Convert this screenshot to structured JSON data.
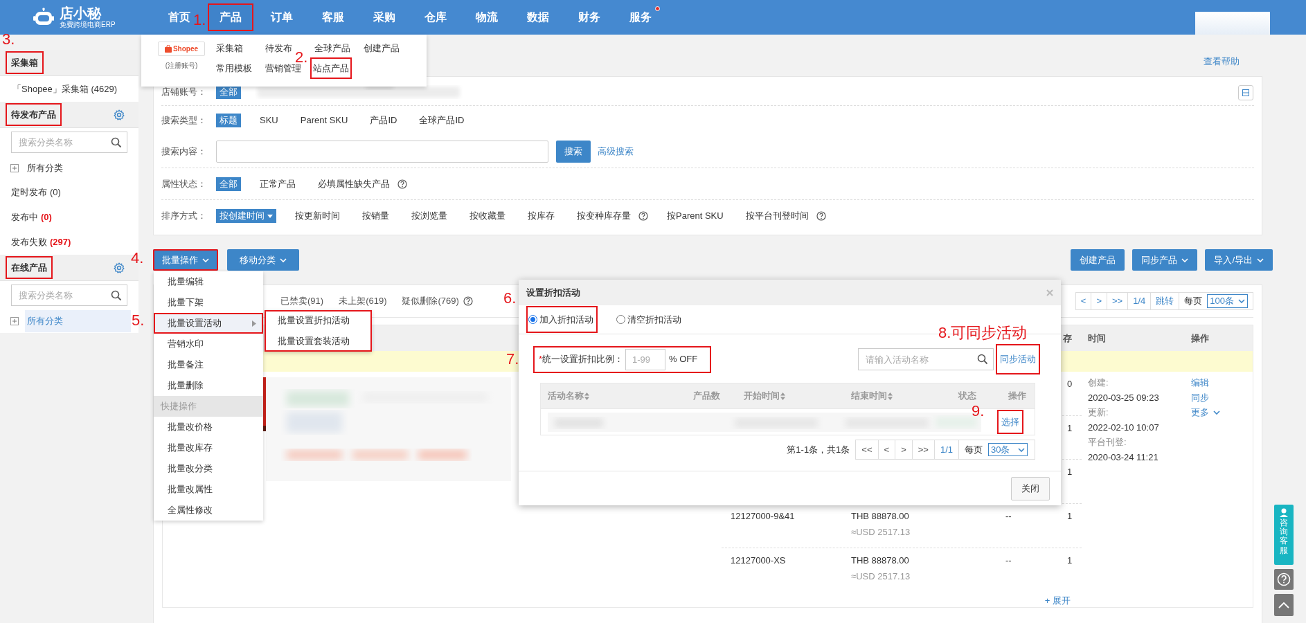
{
  "nav": {
    "logo_text": "店小秘",
    "logo_sub": "免费跨境电商ERP",
    "items": [
      {
        "label": "首页",
        "selected": false,
        "badge": false
      },
      {
        "label": "产品",
        "selected": true,
        "badge": false
      },
      {
        "label": "订单",
        "selected": false,
        "badge": false
      },
      {
        "label": "客服",
        "selected": false,
        "badge": false
      },
      {
        "label": "采购",
        "selected": false,
        "badge": false
      },
      {
        "label": "仓库",
        "selected": false,
        "badge": false
      },
      {
        "label": "物流",
        "selected": false,
        "badge": false
      },
      {
        "label": "数据",
        "selected": false,
        "badge": false
      },
      {
        "label": "财务",
        "selected": false,
        "badge": false
      },
      {
        "label": "服务",
        "selected": false,
        "badge": true
      }
    ]
  },
  "product_menu": {
    "platform": "Shopee",
    "platform_note": "(注册账号)",
    "rows": [
      [
        "采集箱",
        "待发布",
        "全球产品",
        "创建产品"
      ],
      [
        "常用模板",
        "营销管理",
        "站点产品"
      ]
    ]
  },
  "sidebar": {
    "sections": [
      {
        "title": "采集箱",
        "gear": false,
        "items": [
          {
            "kind": "link",
            "label": "「Shopee」采集箱 (4629)"
          }
        ]
      },
      {
        "title": "待发布产品",
        "gear": true,
        "search_placeholder": "搜索分类名称",
        "items": [
          {
            "kind": "tree",
            "label": "所有分类",
            "selected": false
          },
          {
            "kind": "count",
            "label": "定时发布",
            "count": "(0)",
            "alert": false
          },
          {
            "kind": "count",
            "label": "发布中",
            "count": "(0)",
            "alert": true
          },
          {
            "kind": "count",
            "label": "发布失败",
            "count": "(297)",
            "alert": true
          }
        ]
      },
      {
        "title": "在线产品",
        "gear": true,
        "search_placeholder": "搜索分类名称",
        "items": [
          {
            "kind": "tree",
            "label": "所有分类",
            "selected": true
          }
        ]
      }
    ]
  },
  "help_link": "查看帮助",
  "filters": [
    {
      "kind": "options",
      "label": "店铺账号：",
      "redacted": true,
      "options": [
        {
          "label": "全部",
          "selected": true
        }
      ]
    },
    {
      "kind": "options",
      "label": "搜索类型：",
      "options": [
        {
          "label": "标题",
          "selected": true
        },
        {
          "label": "SKU",
          "selected": false
        },
        {
          "label": "Parent SKU",
          "selected": false
        },
        {
          "label": "产品ID",
          "selected": false
        },
        {
          "label": "全球产品ID",
          "selected": false
        }
      ]
    },
    {
      "kind": "search",
      "label": "搜索内容：",
      "button": "搜索",
      "link": "高级搜索"
    },
    {
      "kind": "options",
      "label": "属性状态：",
      "options": [
        {
          "label": "全部",
          "selected": true
        },
        {
          "label": "正常产品",
          "selected": false
        },
        {
          "label": "必填属性缺失产品",
          "selected": false,
          "help": true
        }
      ]
    },
    {
      "kind": "options",
      "label": "排序方式：",
      "options": [
        {
          "label": "按创建时间",
          "selected": true,
          "caret": true
        },
        {
          "label": "按更新时间",
          "selected": false
        },
        {
          "label": "按销量",
          "selected": false
        },
        {
          "label": "按浏览量",
          "selected": false
        },
        {
          "label": "按收藏量",
          "selected": false
        },
        {
          "label": "按库存",
          "selected": false
        },
        {
          "label": "按变种库存量",
          "selected": false,
          "help": true
        },
        {
          "label": "按Parent SKU",
          "selected": false
        },
        {
          "label": "按平台刊登时间",
          "selected": false,
          "help": true
        }
      ]
    }
  ],
  "toolbar": {
    "left": [
      {
        "label": "批量操作",
        "caret": true
      },
      {
        "label": "移动分类",
        "caret": true
      }
    ],
    "right": [
      {
        "label": "创建产品",
        "caret": false
      },
      {
        "label": "同步产品",
        "caret": true
      },
      {
        "label": "导入/导出",
        "caret": true
      }
    ]
  },
  "tabs": [
    {
      "label": "已禁卖(91)",
      "selected": false,
      "help": false
    },
    {
      "label": "未上架(619)",
      "selected": false,
      "help": false
    },
    {
      "label": "疑似删除(769)",
      "selected": false,
      "help": true
    }
  ],
  "pager": {
    "buttons": [
      "<",
      ">",
      ">>"
    ],
    "page": "1/4",
    "jump": "跳转",
    "per_page_label": "每页",
    "per_page": "100条"
  },
  "table": {
    "columns": [
      "存",
      "时间",
      "操作"
    ],
    "times": [
      {
        "label": "创建:",
        "value": "2020-03-25 09:23"
      },
      {
        "label": "更新:",
        "value": "2022-02-10 10:07"
      },
      {
        "label": "平台刊登:",
        "value": "2020-03-24 11:21"
      }
    ],
    "actions": [
      {
        "label": "编辑",
        "caret": false
      },
      {
        "label": "同步",
        "caret": false
      },
      {
        "label": "更多",
        "caret": true
      }
    ],
    "variants": [
      {
        "stock": "0"
      },
      {
        "stock": "1"
      },
      {
        "stock": "1"
      },
      {
        "sku": "12127000-9&41",
        "price": "THB 88878.00",
        "usd": "≈USD 2517.13",
        "column_4": "--",
        "stock": "1"
      },
      {
        "sku": "12127000-XS",
        "price": "THB 88878.00",
        "usd": "≈USD 2517.13",
        "column_4": "--",
        "stock": "1"
      }
    ],
    "expand": "+ 展开"
  },
  "bulk_menu": [
    {
      "kind": "item",
      "label": "批量编辑",
      "selected": false
    },
    {
      "kind": "item",
      "label": "批量下架",
      "selected": false
    },
    {
      "kind": "item",
      "label": "批量设置活动",
      "selected": true,
      "submenu": true
    },
    {
      "kind": "item",
      "label": "营销水印",
      "selected": false
    },
    {
      "kind": "item",
      "label": "批量备注",
      "selected": false
    },
    {
      "kind": "item",
      "label": "批量删除",
      "selected": false
    },
    {
      "kind": "header",
      "label": "快捷操作"
    },
    {
      "kind": "item",
      "label": "批量改价格",
      "selected": false
    },
    {
      "kind": "item",
      "label": "批量改库存",
      "selected": false
    },
    {
      "kind": "item",
      "label": "批量改分类",
      "selected": false
    },
    {
      "kind": "item",
      "label": "批量改属性",
      "selected": false
    },
    {
      "kind": "item",
      "label": "全属性修改",
      "selected": false
    }
  ],
  "submenu": [
    "批量设置折扣活动",
    "批量设置套装活动"
  ],
  "modal": {
    "title": "设置折扣活动",
    "radios": [
      {
        "label": "加入折扣活动",
        "selected": true
      },
      {
        "label": "清空折扣活动",
        "selected": false
      }
    ],
    "required_mark": "*",
    "ratio_label": "统一设置折扣比例：",
    "ratio_placeholder": "1-99",
    "ratio_unit": "% OFF",
    "search_placeholder": "请输入活动名称",
    "sync_link": "同步活动",
    "columns": [
      {
        "label": "活动名称",
        "sortable": true
      },
      {
        "label": "产品数",
        "sortable": false
      },
      {
        "label": "开始时间",
        "sortable": true
      },
      {
        "label": "结束时间",
        "sortable": true
      },
      {
        "label": "状态",
        "sortable": false
      },
      {
        "label": "操作",
        "sortable": false
      }
    ],
    "rows": [
      {
        "action": "选择"
      }
    ],
    "summary": "第1-1条，共1条",
    "pager": {
      "buttons": [
        "<<",
        "<",
        ">",
        ">>"
      ],
      "page": "1/1",
      "per_page_label": "每页",
      "per_page": "30条"
    },
    "close_button": "关闭"
  },
  "support_widget": "咨询客服",
  "annotations": [
    "1.",
    "2.",
    "3.",
    "4.",
    "5.",
    "6.",
    "7.",
    "8.可同步活动",
    "9."
  ]
}
